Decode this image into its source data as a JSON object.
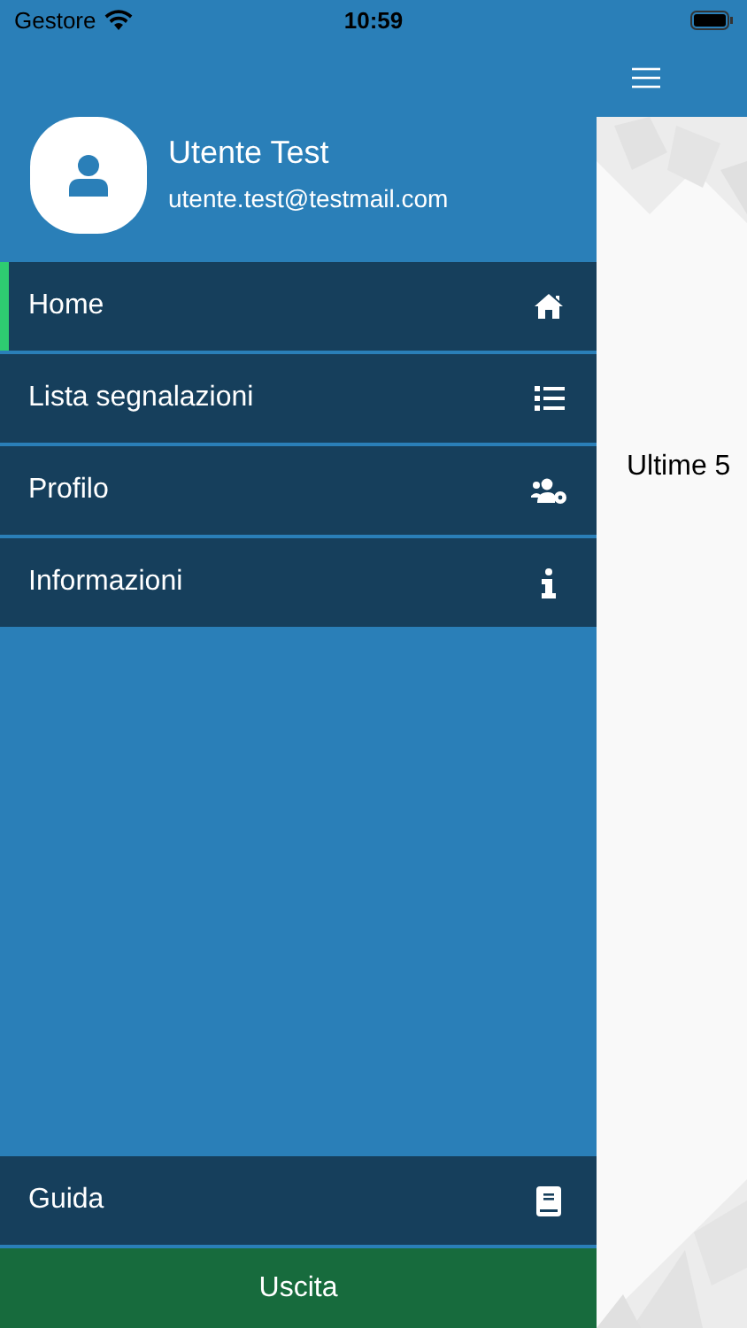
{
  "status_bar": {
    "carrier": "Gestore",
    "time": "10:59"
  },
  "user": {
    "name": "Utente Test",
    "email": "utente.test@testmail.com"
  },
  "menu": [
    {
      "label": "Home",
      "selected": true
    },
    {
      "label": "Lista segnalazioni",
      "selected": false
    },
    {
      "label": "Profilo",
      "selected": false
    },
    {
      "label": "Informazioni",
      "selected": false
    }
  ],
  "footer_item": {
    "label": "Guida"
  },
  "logout_button": {
    "label": "Uscita"
  },
  "main": {
    "heading": "Ultime 5"
  }
}
